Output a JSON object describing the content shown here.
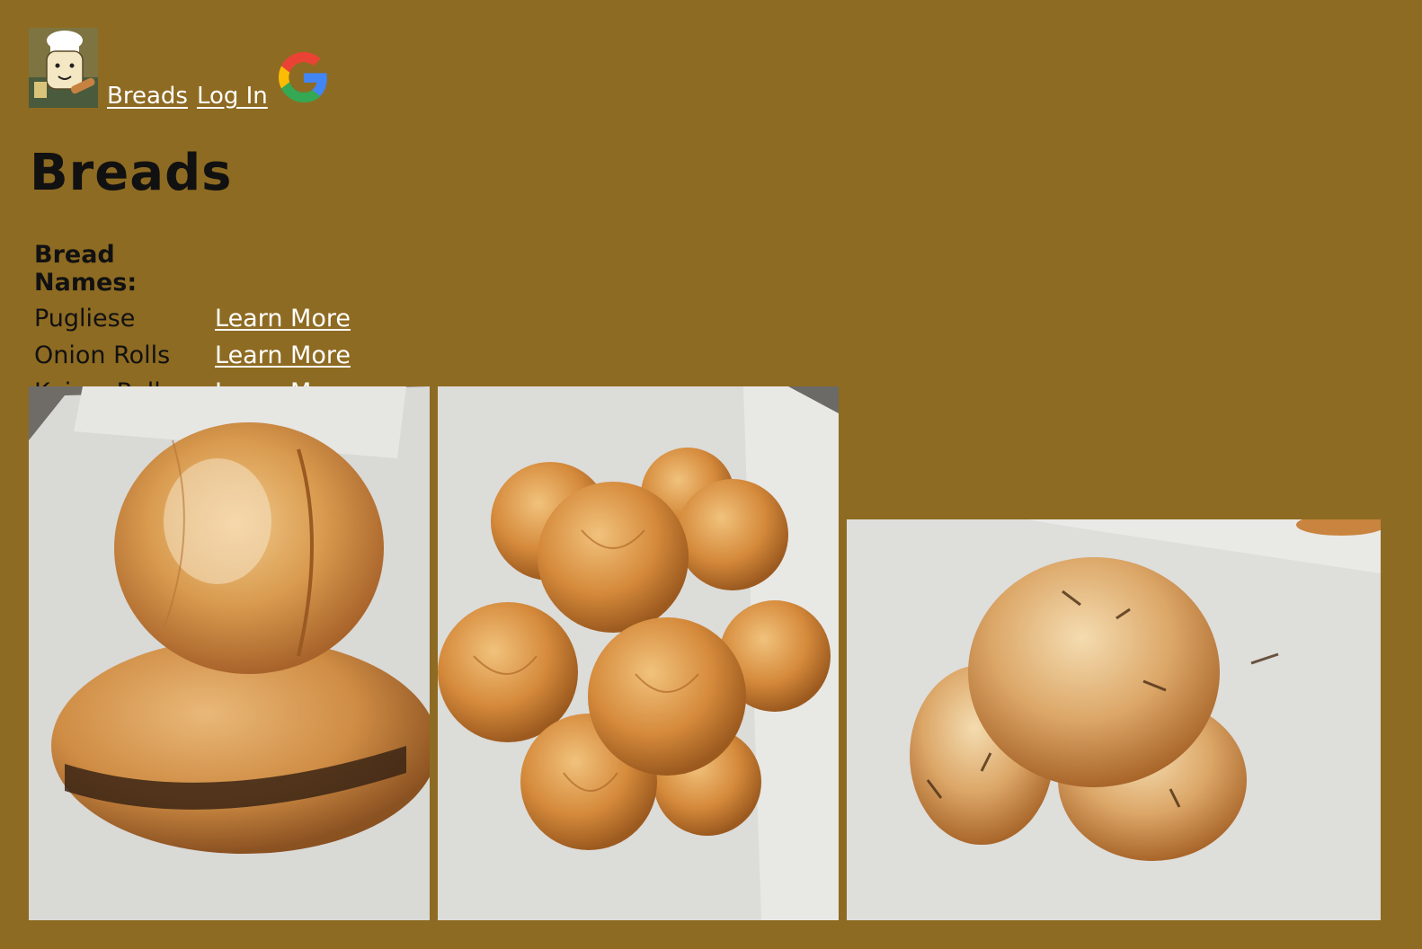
{
  "nav": {
    "logo_icon": "chef-bread-logo",
    "links": [
      {
        "label": "Breads"
      },
      {
        "label": "Log In "
      }
    ],
    "google_icon": "google-g-icon"
  },
  "page": {
    "title": "Breads"
  },
  "breads_table": {
    "header": "Bread Names:",
    "rows": [
      {
        "name": "Pugliese",
        "link": "Learn More"
      },
      {
        "name": "Onion Rolls",
        "link": "Learn More"
      },
      {
        "name": "Kaiser Rolls",
        "link": "Learn More"
      }
    ]
  },
  "photos": [
    {
      "subject": "pugliese-loaves"
    },
    {
      "subject": "kaiser-rolls-pile"
    },
    {
      "subject": "onion-rolls"
    }
  ],
  "colors": {
    "background": "#8e6b22",
    "link": "#ffffff",
    "text": "#111111"
  }
}
